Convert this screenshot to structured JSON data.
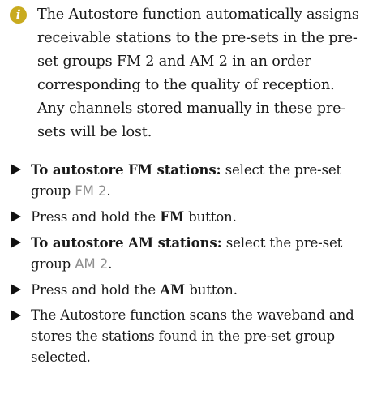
{
  "note": {
    "icon": "info-icon",
    "icon_glyph": "i",
    "icon_color": "#c9ab1f",
    "text": "The Autostore function automatically assigns receivable stations to the pre-sets in the pre-set groups FM 2 and AM 2 in an order corresponding to the quality of reception. Any channels stored manually in these pre-sets will be lost."
  },
  "steps": [
    {
      "lead": "To autostore FM stations:",
      "text": " select the pre-set group ",
      "display": "FM 2",
      "end": "."
    },
    {
      "text": "Press and hold the ",
      "button": "FM",
      "end": " button."
    },
    {
      "lead": "To autostore AM stations:",
      "text": " select the pre-set group ",
      "display": "AM 2",
      "end": "."
    },
    {
      "text": "Press and hold the ",
      "button": "AM",
      "end": " button."
    },
    {
      "text": "The Autostore function scans the waveband and stores the stations found in the pre-set group selected."
    }
  ]
}
